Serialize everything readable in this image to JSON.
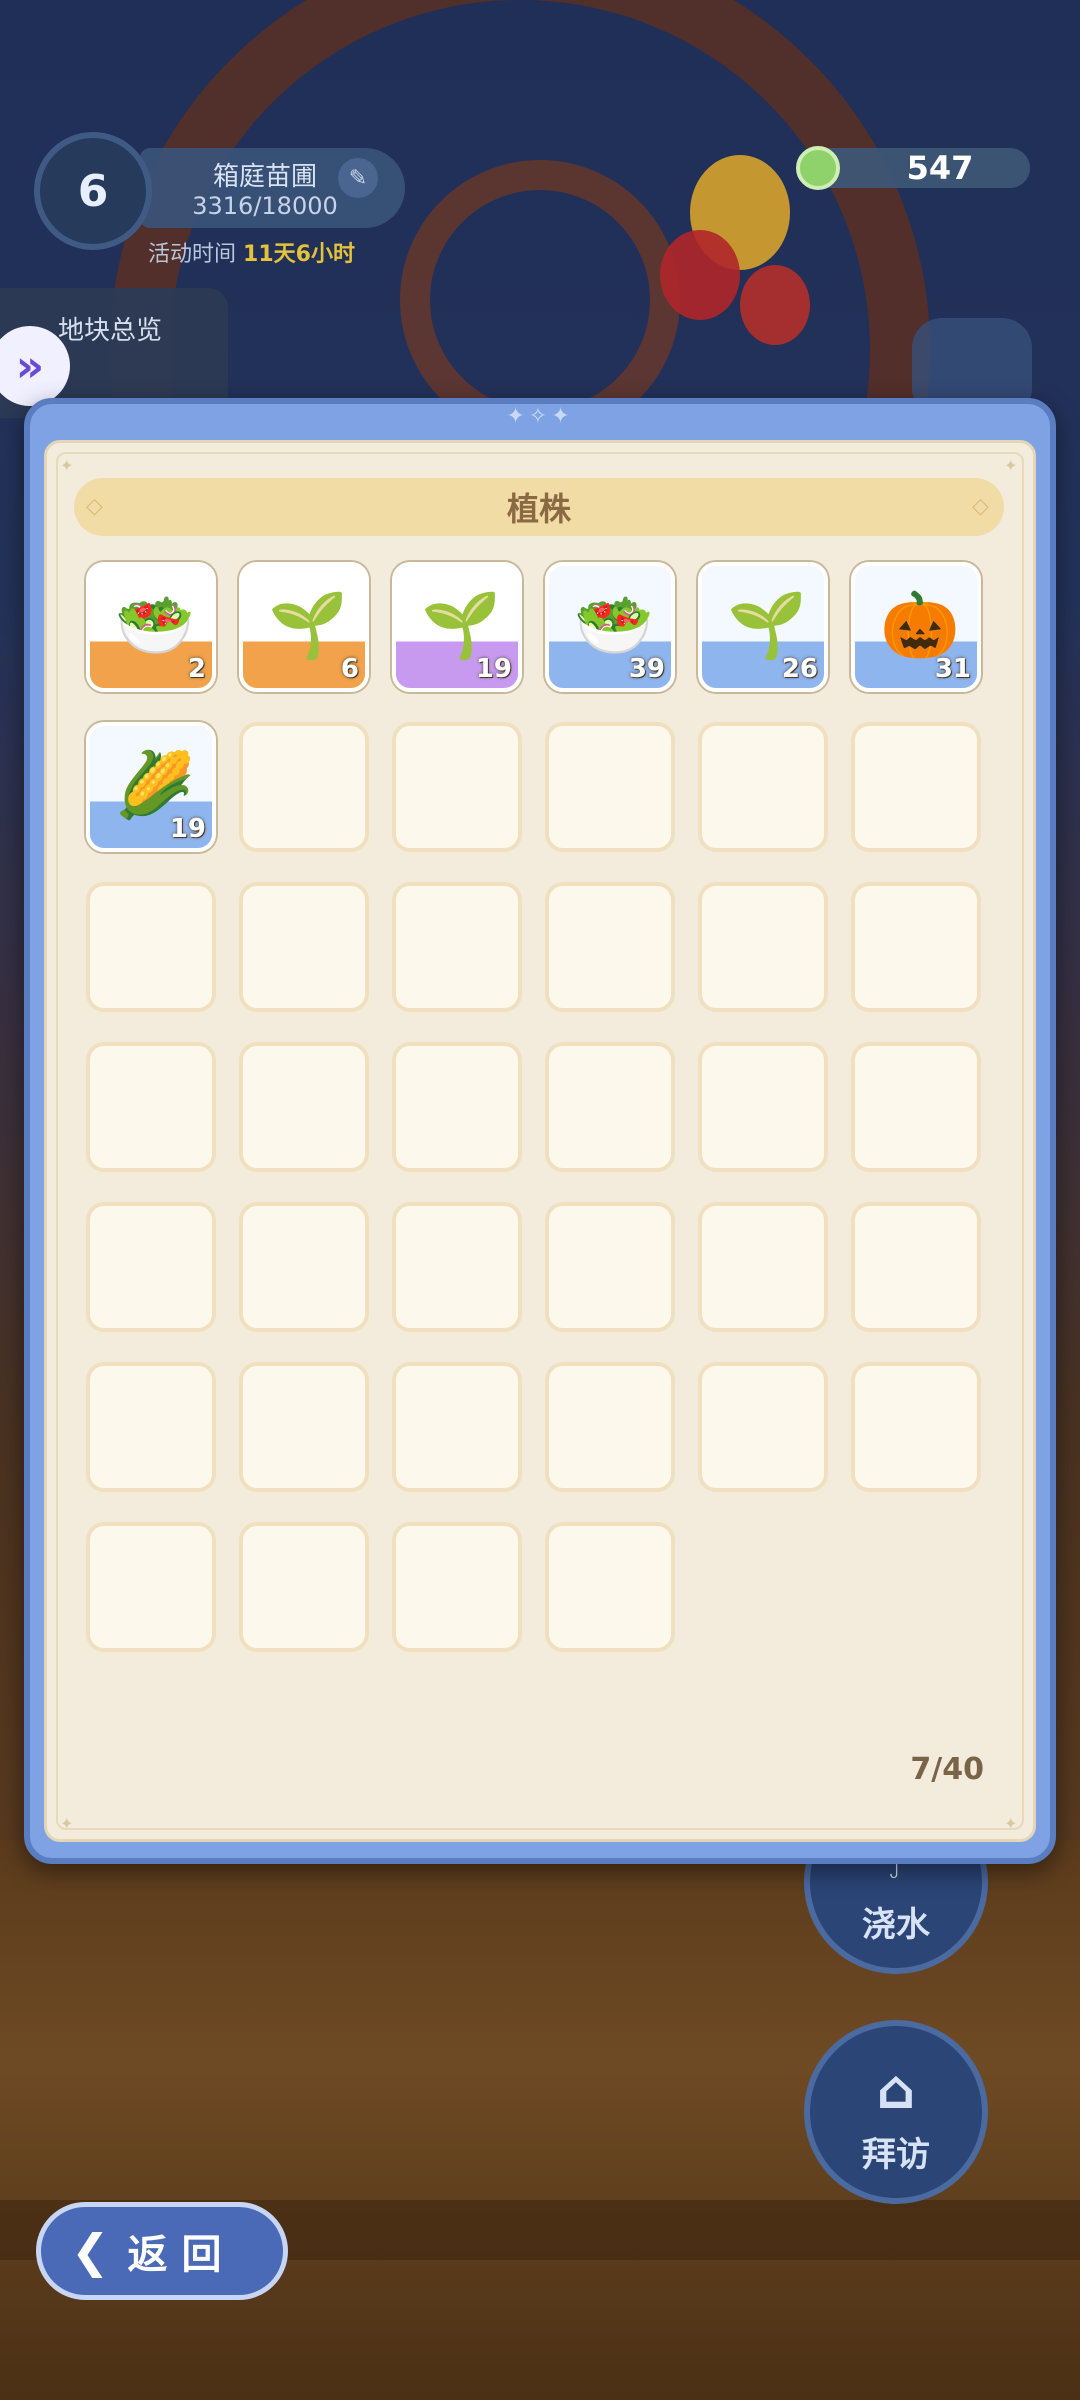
{
  "hud": {
    "level": "6",
    "garden_name": "箱庭苗圃",
    "garden_progress": "3316/18000",
    "event_time_label": "活动时间",
    "event_time_value": "11天6小时",
    "currency_value": "547",
    "plot_overview_label": "地块总览"
  },
  "panel": {
    "title": "植株",
    "capacity": "7/40",
    "items": [
      {
        "name": "veggie-soup-plant",
        "icon": "🥗",
        "rarity": "orange",
        "count": "2"
      },
      {
        "name": "radish-plant",
        "icon": "🌱",
        "rarity": "orange",
        "count": "6"
      },
      {
        "name": "radish-plant",
        "icon": "🌱",
        "rarity": "purple",
        "count": "19"
      },
      {
        "name": "veggie-soup-plant",
        "icon": "🥗",
        "rarity": "blue",
        "count": "39"
      },
      {
        "name": "radish-plant",
        "icon": "🌱",
        "rarity": "blue",
        "count": "26"
      },
      {
        "name": "pumpkin-witch-plant",
        "icon": "🎃",
        "rarity": "blue",
        "count": "31"
      },
      {
        "name": "corn-plant",
        "icon": "🌽",
        "rarity": "blue",
        "count": "19"
      }
    ],
    "empty_slots": 33
  },
  "buttons": {
    "water_label": "浇水",
    "visit_label": "拜访",
    "back_label": "返 回"
  },
  "colors": {
    "panel_blue": "#7ea2e4",
    "panel_cream": "#f3ecdc",
    "title_bar": "#f2dca5",
    "rarity_orange": "#f1a24a",
    "rarity_purple": "#c79af0",
    "rarity_blue": "#8fb5ee",
    "event_highlight": "#e5c23a"
  }
}
